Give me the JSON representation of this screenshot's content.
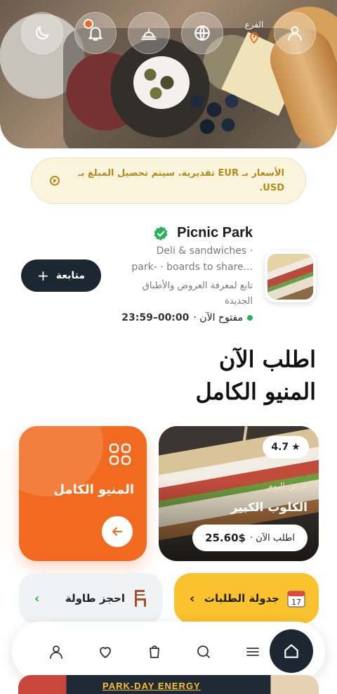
{
  "header": {
    "branch_label": "الفرع",
    "buttons": [
      "profile",
      "language",
      "service",
      "notifications",
      "theme"
    ]
  },
  "notice": {
    "text": "الأسعار بـ EUR تقديرية. سيتم تحصيل المبلغ بـ USD."
  },
  "venue": {
    "name": "Picnic Park",
    "description_line1": "Deli & sandwiches ·",
    "description_line2": "park- · boards to share...",
    "follow_hint": "تابع لمعرفة العروض والأطباق الجديدة",
    "status": "مفتوح الآن ·",
    "hours": "00:00–23:59",
    "follow_button": "متابعة"
  },
  "headline": {
    "line1": "اطلب الآن",
    "line2": "المنيو الكامل"
  },
  "cards": {
    "menu": {
      "label": "المنيو الكامل"
    },
    "offer": {
      "rating": "4.7",
      "tag": "عرض اليوم",
      "name": "الكلوب الكبير",
      "order_label": "اطلب الآن ·",
      "price": "25.60$"
    }
  },
  "actions": {
    "reserve": "احجز طاولة",
    "schedule": "جدولة الطلبات"
  },
  "nav": {
    "items": [
      "profile",
      "favorites",
      "cart",
      "search",
      "menu",
      "home"
    ]
  },
  "banner": {
    "text": "PARK-DAY ENERGY"
  },
  "colors": {
    "accent_orange": "#f26a1f",
    "accent_yellow": "#f9c22e",
    "dark": "#1d2731",
    "green": "#2bb15e"
  }
}
